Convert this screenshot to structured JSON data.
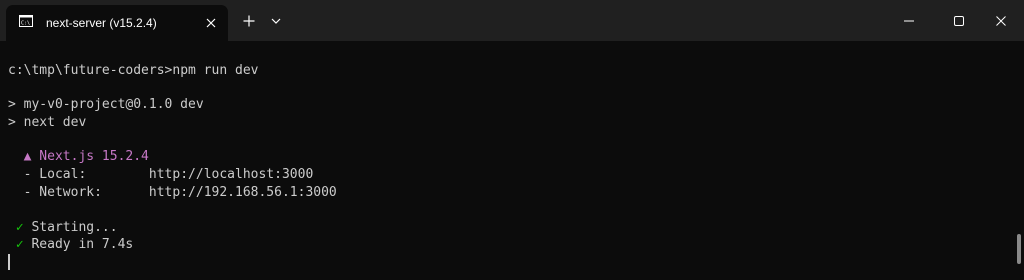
{
  "tab": {
    "title": "next-server (v15.2.4)",
    "icon": "terminal-icon"
  },
  "titlebar": {
    "new_tab_icon": "plus-icon",
    "dropdown_icon": "chevron-down-icon",
    "minimize_icon": "minimize-icon",
    "maximize_icon": "maximize-icon",
    "close_icon": "close-icon"
  },
  "terminal": {
    "prompt": "c:\\tmp\\future-coders>",
    "command": "npm run dev",
    "script_line_1": "> my-v0-project@0.1.0 dev",
    "script_line_2": "> next dev",
    "next_banner": "▲ Next.js 15.2.4",
    "local_label": "- Local:",
    "local_url": "http://localhost:3000",
    "network_label": "- Network:",
    "network_url": "http://192.168.56.1:3000",
    "check_mark": "✓",
    "starting_text": "Starting...",
    "ready_text": "Ready in 7.4s"
  },
  "colors": {
    "background": "#0c0c0c",
    "titlebar": "#202020",
    "text": "#cccccc",
    "next_banner": "#c678c6",
    "check": "#16c60c"
  }
}
